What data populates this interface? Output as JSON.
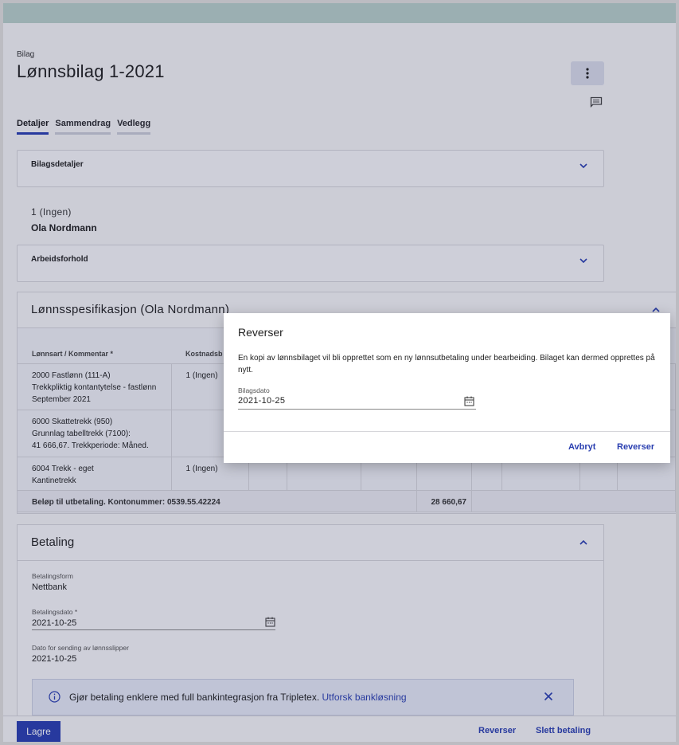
{
  "page": {
    "kicker": "Bilag",
    "title": "Lønnsbilag 1-2021"
  },
  "tabs": [
    {
      "label": "Detaljer",
      "active": true
    },
    {
      "label": "Sammendrag",
      "active": false
    },
    {
      "label": "Vedlegg",
      "active": false
    }
  ],
  "bilagsdetaljer": {
    "title": "Bilagsdetaljer"
  },
  "employee": {
    "number": "1 (Ingen)",
    "name": "Ola Nordmann"
  },
  "arbeidsforhold": {
    "title": "Arbeidsforhold"
  },
  "lonnsspesifikasjon": {
    "title": "Lønnsspesifikasjon (Ola Nordmann)",
    "columns": [
      "Lønnsart / Kommentar *",
      "Kostnadsb"
    ],
    "rows": [
      {
        "line1": "2000 Fastlønn (111-A)",
        "line2": "Trekkpliktig kontantytelse - fastlønn",
        "line3": "September 2021",
        "cost": "1 (Ingen)"
      },
      {
        "line1": "6000 Skattetrekk (950)",
        "line2": "Grunnlag tabelltrekk (7100):",
        "line3": "41 666,67. Trekkperiode: Måned.",
        "cost": ""
      },
      {
        "line1": "6004 Trekk - eget",
        "line2": "Kantinetrekk",
        "line3": "",
        "cost": "1 (Ingen)"
      }
    ],
    "sum_label": "Beløp til utbetaling. Kontonummer: 0539.55.42224",
    "sum_value": "28 660,67"
  },
  "betaling": {
    "title": "Betaling",
    "betalingsform_label": "Betalingsform",
    "betalingsform_value": "Nettbank",
    "betalingsdato_label": "Betalingsdato *",
    "betalingsdato_value": "2021-10-25",
    "sending_label": "Dato for sending av lønnsslipper",
    "sending_value": "2021-10-25",
    "info_text": "Gjør betaling enklere med full bankintegrasjon fra Tripletex.",
    "info_link": "Utforsk bankløsning"
  },
  "footer": {
    "save": "Lagre",
    "reverser": "Reverser",
    "slett": "Slett betaling"
  },
  "modal": {
    "title": "Reverser",
    "body": "En kopi av lønnsbilaget vil bli opprettet som en ny lønnsutbetaling under bearbeiding. Bilaget kan dermed opprettes på nytt.",
    "date_label": "Bilagsdato",
    "date_value": "2021-10-25",
    "cancel": "Avbryt",
    "confirm": "Reverser"
  },
  "colors": {
    "accent": "#2a3fb0",
    "topbar": "#b8cfc9"
  }
}
